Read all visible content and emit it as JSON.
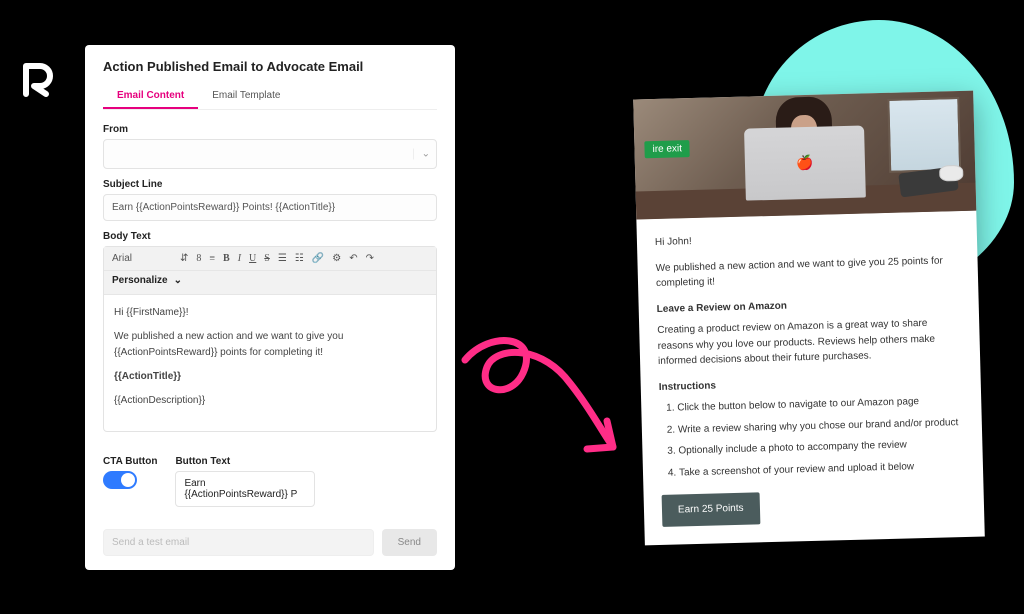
{
  "editor": {
    "title": "Action Published Email to Advocate Email",
    "tabs": {
      "content": "Email Content",
      "template": "Email Template"
    },
    "from_label": "From",
    "subject_label": "Subject Line",
    "subject_value": "Earn {{ActionPointsReward}} Points! {{ActionTitle}}",
    "body_label": "Body Text",
    "toolbar": {
      "font": "Arial",
      "personalize": "Personalize"
    },
    "body": {
      "line1": "Hi {{FirstName}}!",
      "line2": "We published a new action and we want to give you {{ActionPointsReward}} points for completing it!",
      "line3": "{{ActionTitle}}",
      "line4": "{{ActionDescription}}"
    },
    "cta_label": "CTA Button",
    "button_text_label": "Button Text",
    "button_text_value": "Earn {{ActionPointsReward}} P",
    "test_placeholder": "Send a test email",
    "send_label": "Send"
  },
  "preview": {
    "exit_sign": "ire exit",
    "greeting": "Hi John!",
    "intro": "We published a new action and we want to give you 25 points for completing it!",
    "action_title": "Leave a Review on Amazon",
    "action_desc": "Creating a product review on Amazon is a great way to share reasons why you love our products. Reviews help others make informed decisions about their future purchases.",
    "instructions_label": "Instructions",
    "steps": [
      "Click the button below to navigate to our Amazon page",
      "Write a review sharing why you chose our brand and/or product",
      "Optionally include a photo to accompany the review",
      "Take a screenshot of your review and upload it below"
    ],
    "cta": "Earn 25 Points"
  }
}
